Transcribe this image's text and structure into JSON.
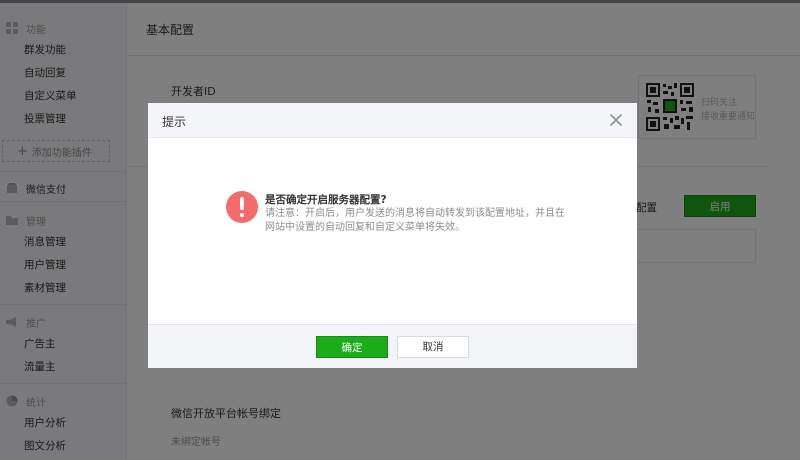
{
  "sidebar": {
    "sections": [
      {
        "label": "功能",
        "icon": "grid-icon",
        "items": [
          "群发功能",
          "自动回复",
          "自定义菜单",
          "投票管理"
        ]
      },
      {
        "label": "微信支付",
        "icon": "wallet-icon",
        "items": []
      },
      {
        "label": "管理",
        "icon": "folder-icon",
        "items": [
          "消息管理",
          "用户管理",
          "素材管理"
        ]
      },
      {
        "label": "推广",
        "icon": "megaphone-icon",
        "items": [
          "广告主",
          "流量主"
        ]
      },
      {
        "label": "统计",
        "icon": "pie-chart-icon",
        "items": [
          "用户分析",
          "图文分析"
        ]
      }
    ],
    "add_plugin": "添加功能插件"
  },
  "main": {
    "title": "基本配置",
    "developer_id_label": "开发者ID",
    "qr_text_line1": "扫码关注",
    "qr_text_line2": "接收重要通知",
    "config_link": "配置",
    "enable_button": "启用",
    "bind_title": "微信开放平台帐号绑定",
    "bind_status": "未绑定帐号"
  },
  "dialog": {
    "title": "提示",
    "message_title": "是否确定开启服务器配置?",
    "message_desc": "请注意：开启后，用户发送的消息将自动转发到该配置地址，并且在网站中设置的自动回复和自定义菜单将失效。",
    "ok_label": "确定",
    "cancel_label": "取消"
  },
  "colors": {
    "accent_green": "#1aad19",
    "warning_red": "#f36b6b"
  }
}
